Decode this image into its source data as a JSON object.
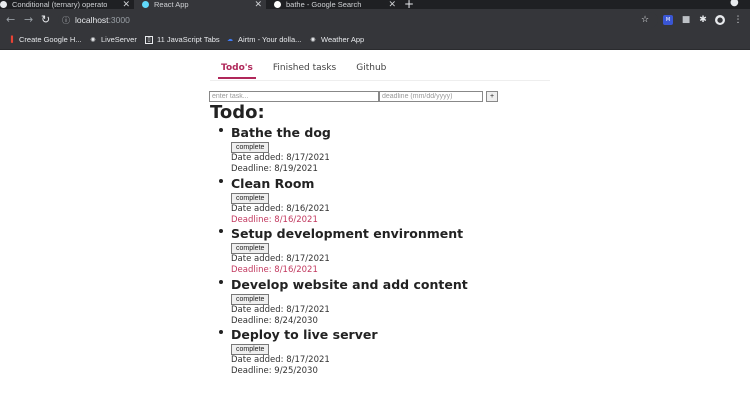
{
  "browser": {
    "tabs": [
      {
        "title": "Conditional (ternary) operato",
        "close": "✕",
        "color": "#e8eaed"
      },
      {
        "title": "React App",
        "close": "✕",
        "color": "#61dafb"
      },
      {
        "title": "bathe - Google Search",
        "close": "✕",
        "color": "#ffffff"
      }
    ],
    "new_tab": "+",
    "url_host": "localhost",
    "url_port": ":3000",
    "bookmarks": [
      {
        "label": "Create Google H...",
        "icon": "google-icon",
        "color": "#ea4335"
      },
      {
        "label": "LiveServer",
        "icon": "globe-icon",
        "color": "#e8eaed"
      },
      {
        "label": "11 JavaScript Tabs",
        "icon": "bookmark-icon",
        "color": "#e8eaed"
      },
      {
        "label": "Airtm - Your dolla...",
        "icon": "airtm-icon",
        "color": "#3f7bf6"
      },
      {
        "label": "Weather App",
        "icon": "globe-icon",
        "color": "#e8eaed"
      }
    ]
  },
  "app": {
    "nav": [
      {
        "label": "Todo's",
        "active": true
      },
      {
        "label": "Finished tasks",
        "active": false
      },
      {
        "label": "Github",
        "active": false
      }
    ],
    "form": {
      "task_placeholder": "enter task...",
      "deadline_placeholder": "deadline (mm/dd/yyyy)",
      "add_label": "+"
    },
    "heading": "Todo:",
    "complete_label": "complete",
    "items": [
      {
        "title": "Bathe the dog",
        "date_added": "Date added: 8/17/2021",
        "deadline": "Deadline: 8/19/2021",
        "overdue": false
      },
      {
        "title": "Clean Room",
        "date_added": "Date added: 8/16/2021",
        "deadline": "Deadline: 8/16/2021",
        "overdue": true
      },
      {
        "title": "Setup development environment",
        "date_added": "Date added: 8/17/2021",
        "deadline": "Deadline: 8/16/2021",
        "overdue": true
      },
      {
        "title": "Develop website and add content",
        "date_added": "Date added: 8/17/2021",
        "deadline": "Deadline: 8/24/2030",
        "overdue": false
      },
      {
        "title": "Deploy to live server",
        "date_added": "Date added: 8/17/2021",
        "deadline": "Deadline: 9/25/2030",
        "overdue": false
      }
    ]
  },
  "colors": {
    "accent": "#b0285a",
    "overdue": "#c2395f",
    "chrome_dark": "#1f2023",
    "chrome": "#35363a"
  }
}
